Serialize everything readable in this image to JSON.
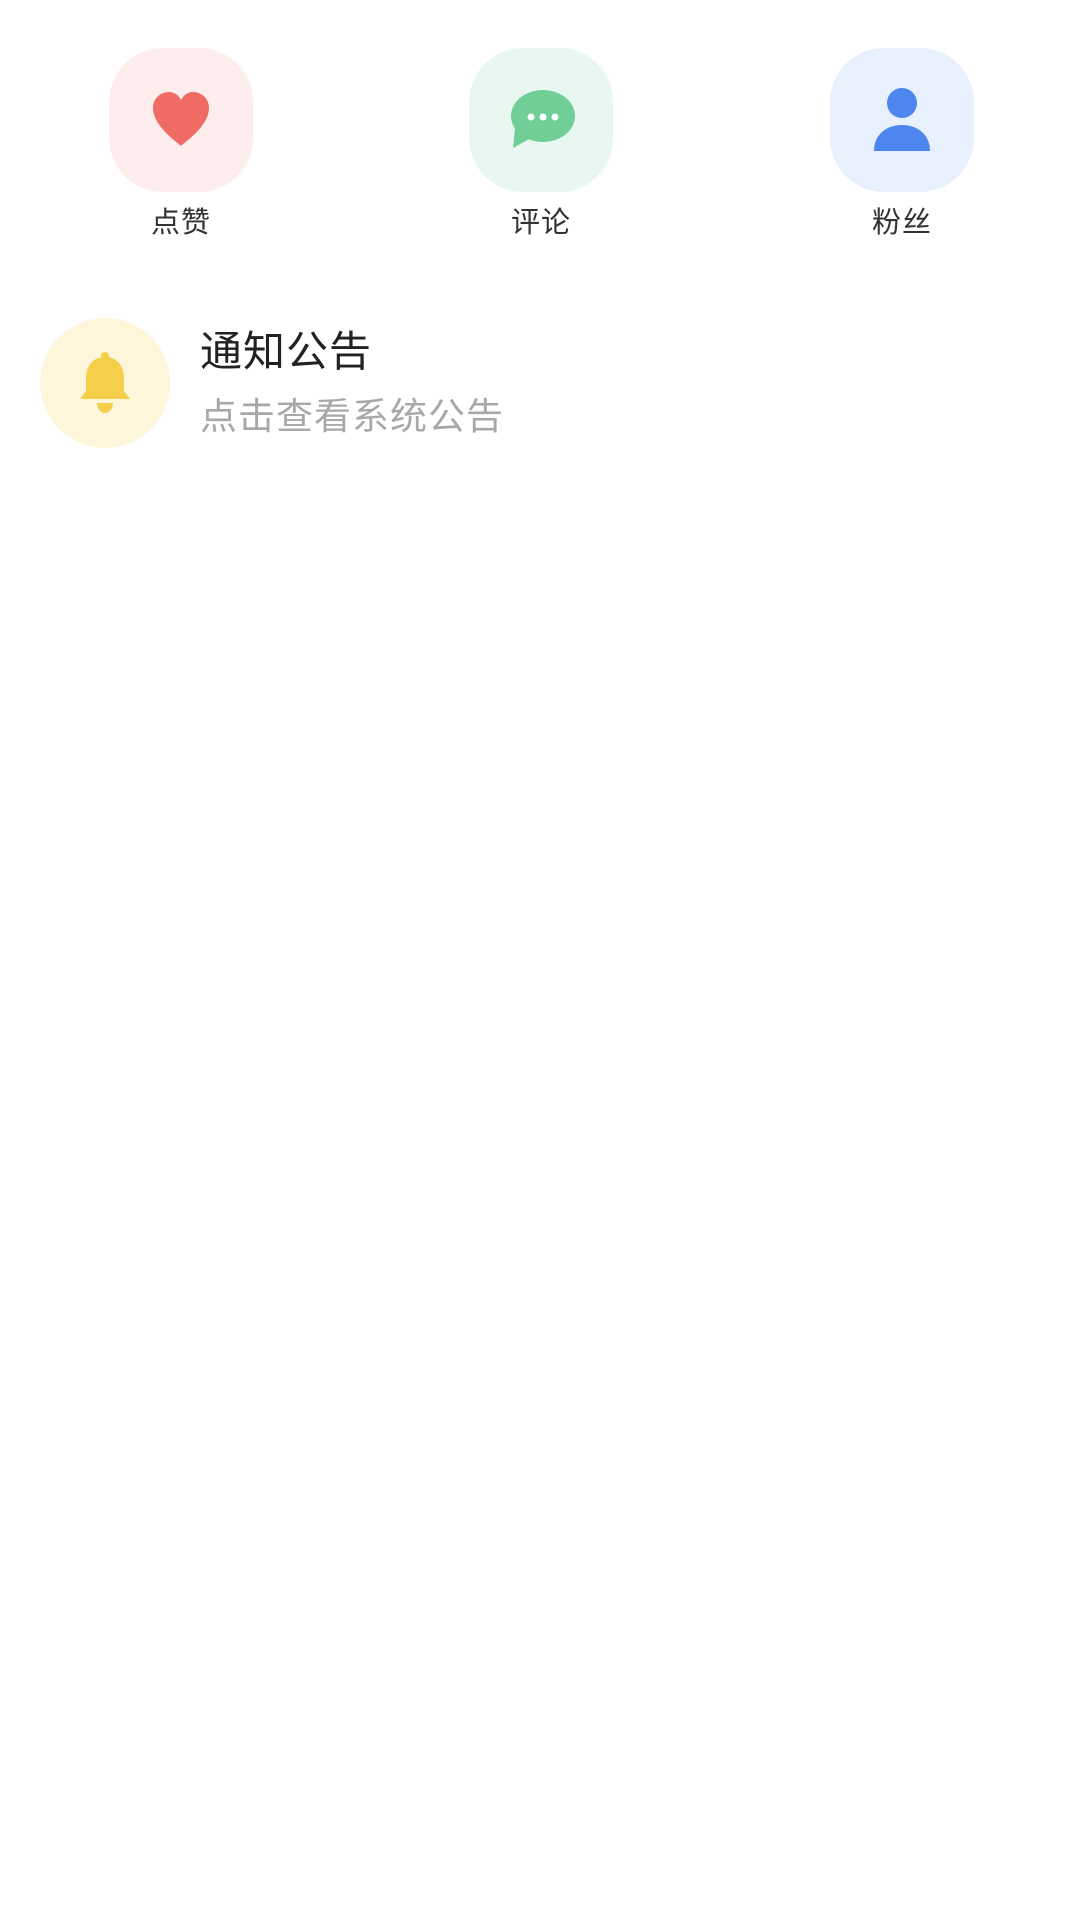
{
  "categories": [
    {
      "label": "点赞",
      "icon": "heart-icon",
      "icon_color": "#EF6B63",
      "tile_color": "#FDEDEC"
    },
    {
      "label": "评论",
      "icon": "chat-bubble-icon",
      "icon_color": "#6FCF97",
      "tile_color": "#E8F8F0"
    },
    {
      "label": "粉丝",
      "icon": "person-icon",
      "icon_color": "#4E86F0",
      "tile_color": "#E8F0FD"
    }
  ],
  "notice": {
    "title": "通知公告",
    "subtitle": "点击查看系统公告",
    "icon": "bell-icon",
    "icon_color": "#F5CF4A",
    "tile_color": "#FEF6DB"
  }
}
